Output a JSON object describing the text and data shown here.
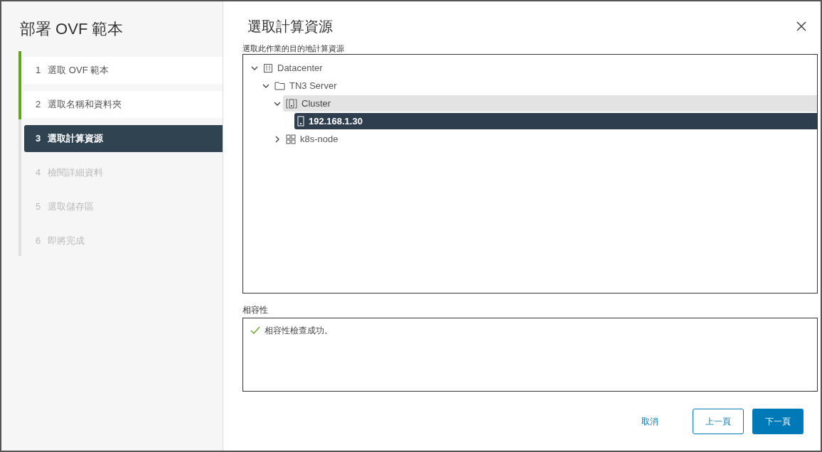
{
  "wizard": {
    "title": "部署 OVF 範本"
  },
  "steps": [
    {
      "number": "1",
      "label": "選取 OVF 範本",
      "completed": true,
      "disabled": false,
      "selected": false
    },
    {
      "number": "2",
      "label": "選取名稱和資料夾",
      "completed": true,
      "disabled": false,
      "selected": false
    },
    {
      "number": "3",
      "label": "選取計算資源",
      "completed": false,
      "disabled": false,
      "selected": true
    },
    {
      "number": "4",
      "label": "檢閱詳細資料",
      "completed": false,
      "disabled": true,
      "selected": false
    },
    {
      "number": "5",
      "label": "選取儲存區",
      "completed": false,
      "disabled": true,
      "selected": false
    },
    {
      "number": "6",
      "label": "即將完成",
      "completed": false,
      "disabled": true,
      "selected": false
    }
  ],
  "page": {
    "title": "選取計算資源",
    "tree_label": "選取此作業的目的地計算資源",
    "tree": [
      {
        "label": "Datacenter",
        "kind": "datacenter",
        "expanded": true,
        "selected": false,
        "hovered": false,
        "children": [
          {
            "label": "TN3 Server",
            "kind": "folder",
            "expanded": true,
            "selected": false,
            "hovered": false,
            "children": [
              {
                "label": "Cluster",
                "kind": "cluster",
                "expanded": true,
                "selected": false,
                "hovered": true,
                "children": [
                  {
                    "label": "192.168.1.30",
                    "kind": "host",
                    "selected": true
                  }
                ]
              },
              {
                "label": "k8s-node",
                "kind": "vapp",
                "expanded": false,
                "selected": false,
                "hovered": false
              }
            ]
          }
        ]
      }
    ],
    "compatibility": {
      "label": "相容性",
      "message": "相容性檢查成功。",
      "ok": true
    }
  },
  "buttons": {
    "cancel": "取消",
    "back": "上一頁",
    "next": "下一頁"
  }
}
